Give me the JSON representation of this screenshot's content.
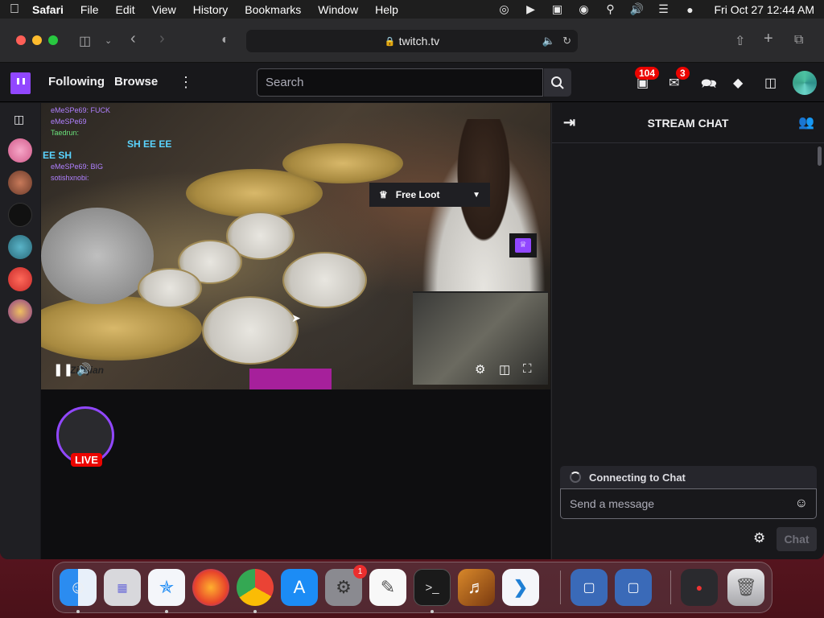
{
  "menubar": {
    "app_name": "Safari",
    "items": [
      "File",
      "Edit",
      "View",
      "History",
      "Bookmarks",
      "Window",
      "Help"
    ],
    "clock": "Fri Oct 27  12:44 AM"
  },
  "browser": {
    "url": "twitch.tv"
  },
  "twitch_nav": {
    "following": "Following",
    "browse": "Browse",
    "search_placeholder": "Search",
    "notifications_count": "104",
    "inbox_count": "3"
  },
  "video": {
    "chat_overlay": [
      "eMeSPe69: FUCK",
      "eMeSPe69",
      "Taedrun:",
      "SH EE EE",
      "EE SH",
      "eMeSPe69: BIG",
      "sotishxnobi:"
    ],
    "free_loot_label": "Free Loot",
    "brand_text": "Zildjian"
  },
  "channel": {
    "live_label": "LIVE"
  },
  "chat": {
    "title": "STREAM CHAT",
    "status": "Connecting to Chat",
    "input_placeholder": "Send a message",
    "send_label": "Chat"
  },
  "dock": {
    "settings_badge": "1",
    "apps": [
      "Finder",
      "Launchpad",
      "Safari",
      "Firefox",
      "Chrome",
      "App Store",
      "System Settings",
      "TextEdit",
      "Terminal",
      "GarageBand",
      "VS Code",
      "VirtualBox",
      "VirtualBox",
      "Chrome App",
      "Trash"
    ]
  },
  "colors": {
    "twitch_purple": "#9147ff",
    "live_red": "#eb0400",
    "bg_dark": "#18181b"
  }
}
